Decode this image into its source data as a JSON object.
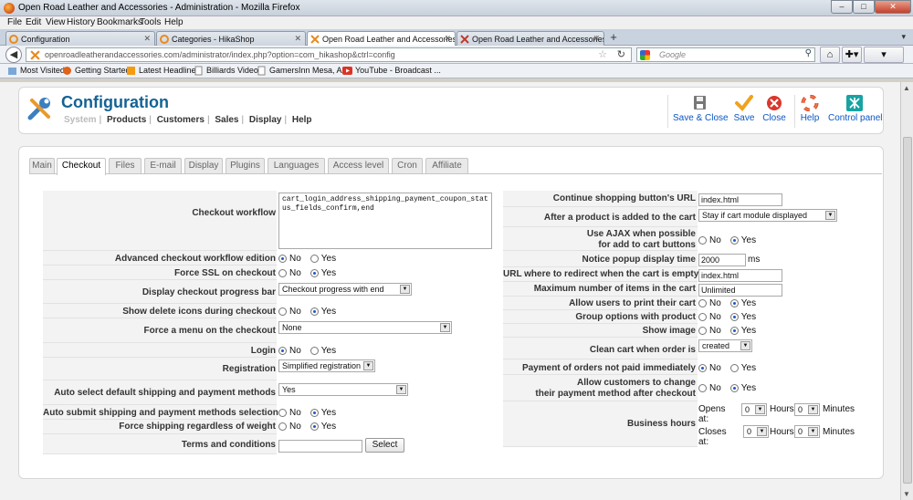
{
  "window": {
    "title": "Open Road Leather and Accessories - Administration - Mozilla Firefox",
    "controls": [
      "–",
      "□",
      "✕"
    ]
  },
  "menubar": [
    "File",
    "Edit",
    "View",
    "History",
    "Bookmarks",
    "Tools",
    "Help"
  ],
  "browser_tabs": [
    {
      "label": "Configuration",
      "close": "✕"
    },
    {
      "label": "Categories - HikaShop",
      "close": "✕"
    },
    {
      "label": "Open Road Leather and Accessories -...",
      "close": "✕"
    },
    {
      "label": "Open Road Leather and Accessories -...",
      "close": "✕"
    }
  ],
  "nav": {
    "back": "◀",
    "url": "openroadleatherandaccessories.com/administrator/index.php?option=com_hikashop&ctrl=config",
    "star": "☆",
    "reload": "↻",
    "search_placeholder": "Google",
    "search_icon": "⚲",
    "home": "⌂",
    "tools": "✚▾",
    "addon": "▾"
  },
  "bookmarks": [
    "Most Visited",
    "Getting Started",
    "Latest Headlines",
    "Billiards Videos",
    "GamersInn Mesa, AZ -",
    "YouTube - Broadcast ..."
  ],
  "header": {
    "title": "Configuration",
    "submenu": [
      "System",
      "Products",
      "Customers",
      "Sales",
      "Display",
      "Help"
    ],
    "toolbar": [
      "Save & Close",
      "Save",
      "Close",
      "Help",
      "Control panel"
    ]
  },
  "tabs": [
    "Main",
    "Checkout",
    "Files",
    "E-mail",
    "Display",
    "Plugins",
    "Languages",
    "Access level",
    "Cron",
    "Affiliate"
  ],
  "left": {
    "checkout_workflow": {
      "label": "Checkout workflow",
      "value": "cart_login_address_shipping_payment_coupon_status_fields_confirm,end"
    },
    "advanced_workflow": {
      "label": "Advanced checkout workflow edition",
      "yes": "Yes",
      "no": "No"
    },
    "force_ssl": {
      "label": "Force SSL on checkout",
      "yes": "Yes",
      "no": "No"
    },
    "progress_bar": {
      "label": "Display checkout progress bar",
      "value": "Checkout progress with end"
    },
    "delete_icons": {
      "label": "Show delete icons during checkout",
      "yes": "Yes",
      "no": "No"
    },
    "force_menu": {
      "label": "Force a menu on the checkout",
      "value": "None"
    },
    "login": {
      "label": "Login",
      "yes": "Yes",
      "no": "No"
    },
    "registration": {
      "label": "Registration",
      "value": "Simplified registration"
    },
    "auto_select": {
      "label": "Auto select default shipping and payment methods",
      "value": "Yes"
    },
    "auto_submit": {
      "label": "Auto submit shipping and payment methods selection",
      "yes": "Yes",
      "no": "No"
    },
    "force_shipping": {
      "label": "Force shipping regardless of weight",
      "yes": "Yes",
      "no": "No"
    },
    "terms": {
      "label": "Terms and conditions",
      "value": "",
      "button": "Select"
    }
  },
  "right": {
    "continue_url": {
      "label": "Continue shopping button's URL",
      "value": "index.html"
    },
    "after_add": {
      "label": "After a product is added to the cart",
      "value": "Stay if cart module displayed"
    },
    "ajax": {
      "label1": "Use AJAX when possible",
      "label2": "for add to cart buttons",
      "yes": "Yes",
      "no": "No"
    },
    "popup_time": {
      "label": "Notice popup display time",
      "value": "2000",
      "unit": "ms"
    },
    "redirect_url": {
      "label": "URL where to redirect when the cart is empty",
      "value": "index.html"
    },
    "max_items": {
      "label": "Maximum number of items in the cart",
      "value": "Unlimited"
    },
    "print_cart": {
      "label": "Allow users to print their cart",
      "yes": "Yes",
      "no": "No"
    },
    "group_options": {
      "label": "Group options with product",
      "yes": "Yes",
      "no": "No"
    },
    "show_image": {
      "label": "Show image",
      "yes": "Yes",
      "no": "No"
    },
    "clean_cart": {
      "label": "Clean cart when order is",
      "value": "created"
    },
    "payment_not_paid": {
      "label": "Payment of orders not paid immediately",
      "yes": "Yes",
      "no": "No"
    },
    "change_payment": {
      "label1": "Allow customers to change",
      "label2": "their payment method after checkout",
      "yes": "Yes",
      "no": "No"
    },
    "business_hours": {
      "label": "Business hours",
      "opens": "Opens at:",
      "closes": "Closes at:",
      "hours": "Hours",
      "minutes": "Minutes",
      "open_h": "0",
      "open_m": "0",
      "close_h": "0",
      "close_m": "0"
    }
  }
}
